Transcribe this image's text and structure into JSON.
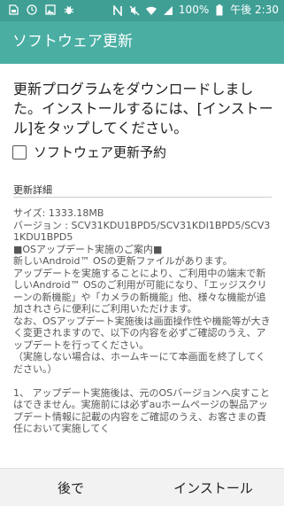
{
  "status_bar": {
    "battery": "100%",
    "time": "午後 2:30",
    "left_icons": [
      "sim-card-icon",
      "clock-icon",
      "image-icon",
      "bug-icon"
    ],
    "right_icons": [
      "nfc-icon",
      "mute-icon",
      "wifi-icon",
      "signal-icon",
      "battery-icon"
    ]
  },
  "app_bar": {
    "title": "ソフトウェア更新"
  },
  "main": {
    "message": "更新プログラムをダウンロードしました。インストールするには、[インストール]をタップしてください。",
    "schedule_checkbox": {
      "label": "ソフトウェア更新予約",
      "checked": false
    },
    "details_title": "更新詳細",
    "details_text": "サイズ: 1333.18MB\nバージョン : SCV31KDU1BPD5/SCV31KDI1BPD5/SCV31KDU1BPD5\n■OSアップデート実施のご案内■\n新しいAndroid™ OSの更新ファイルがあります。\nアップデートを実施することにより、ご利用中の端末で新しいAndroid™ OSのご利用が可能になり、「エッジスクリーンの新機能」や「カメラの新機能」他、様々な機能が追加されさらに便利にご利用いただけます。\nなお、OSアップデート実施後は画面操作性や機能等が大きく変更されますので、以下の内容を必ずご確認のうえ、アップデートを行ってください。\n（実施しない場合は、ホームキーにて本画面を終了してください。）\n\n1、 アップデート実施後は、元のOSバージョンへ戻すことはできません。実施前には必ずauホームページの製品アップデート情報に記載の内容をご確認のうえ、お客さまの責任において実施してく"
  },
  "footer": {
    "later_label": "後で",
    "install_label": "インストール"
  },
  "colors": {
    "status_bar": "#3f9f95",
    "app_bar": "#4aaea3",
    "footer": "#f2f2f2"
  }
}
